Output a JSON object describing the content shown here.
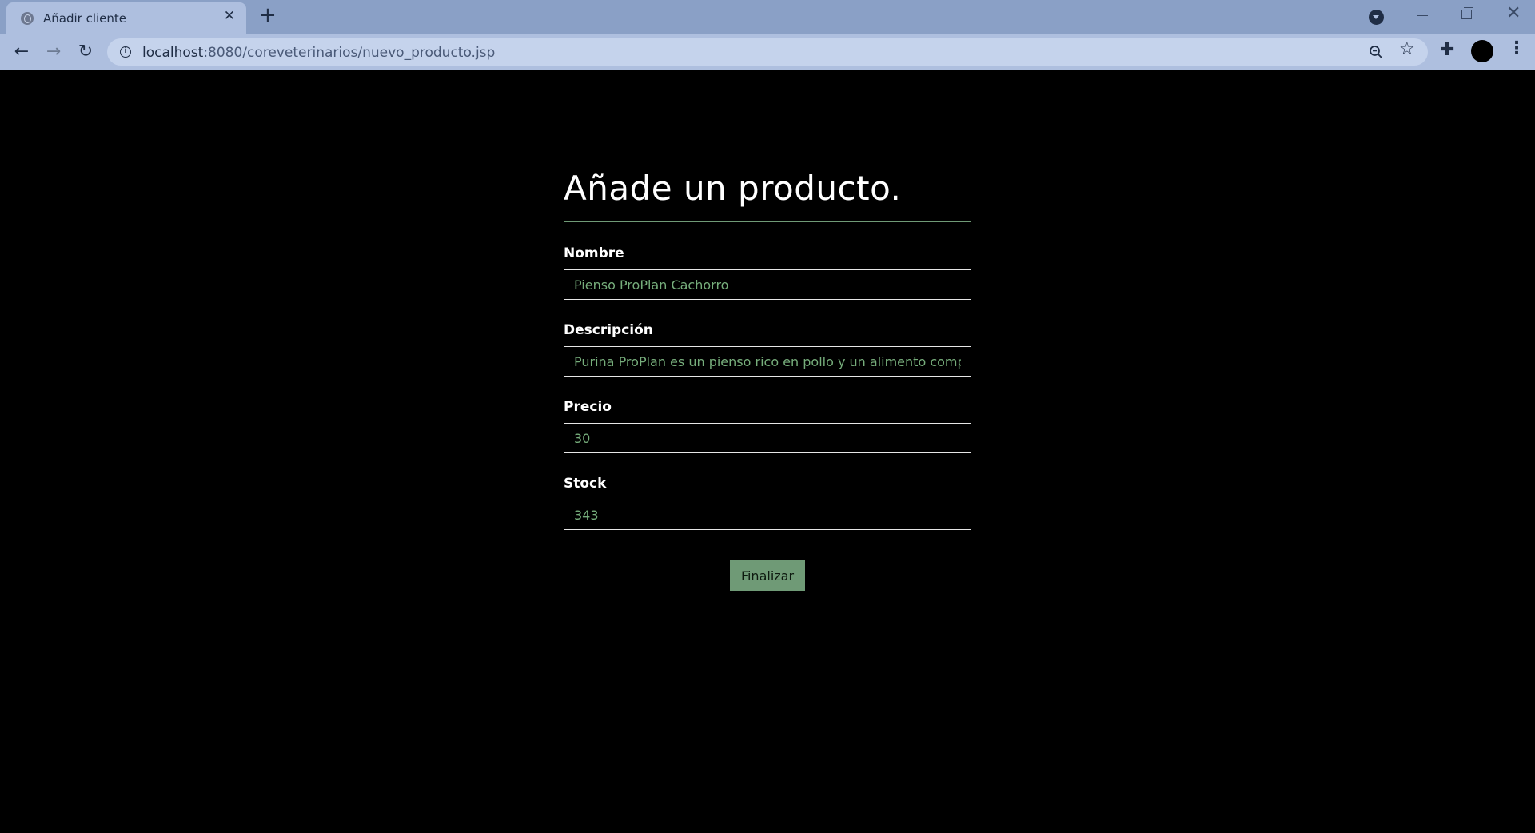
{
  "browser": {
    "tab_title": "Añadir cliente",
    "tab_close": "✕",
    "new_tab": "+",
    "url_host": "localhost",
    "url_path": ":8080/coreveterinarios/nuevo_producto.jsp",
    "icons": {
      "favicon": "globe-icon",
      "back": "arrow-left-icon",
      "forward": "arrow-right-icon",
      "reload": "reload-icon",
      "info": "info-icon",
      "zoom": "zoom-out-icon",
      "bookmark": "star-icon",
      "extensions": "puzzle-icon",
      "profile": "avatar",
      "menu": "kebab-menu-icon"
    }
  },
  "form": {
    "title": "Añade un producto.",
    "fields": [
      {
        "label": "Nombre",
        "value": "Pienso ProPlan Cachorro"
      },
      {
        "label": "Descripción",
        "value": "Purina ProPlan es un pienso rico en pollo y un alimento completo"
      },
      {
        "label": "Precio",
        "value": "30"
      },
      {
        "label": "Stock",
        "value": "343"
      }
    ],
    "submit_label": "Finalizar"
  },
  "colors": {
    "accent": "#6f9a76",
    "input_text": "#76ad7b",
    "background": "#000000",
    "chrome": "#aebfdf"
  }
}
